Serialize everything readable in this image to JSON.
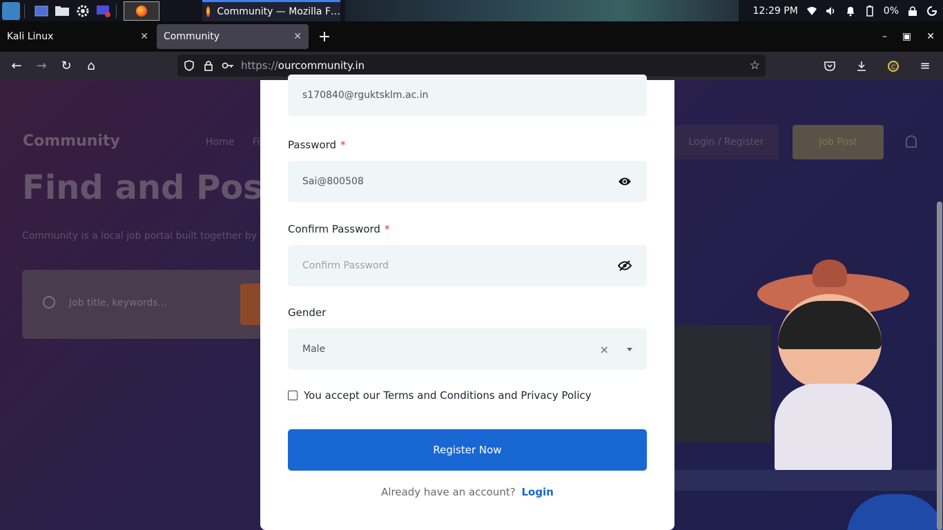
{
  "taskbar": {
    "window_title": "Community — Mozilla F…",
    "clock": "12:29 PM",
    "battery": "0%"
  },
  "browser": {
    "tabs": [
      {
        "label": "Kali Linux",
        "active": false
      },
      {
        "label": "Community",
        "active": true
      }
    ],
    "url_protocol": "https://",
    "url_host": "ourcommunity.in"
  },
  "background_page": {
    "brand": "Community",
    "nav_home": "Home",
    "nav_partial": "Fi",
    "hero_title": "Find and Post In",
    "hero_subtitle": "Community is a local job portal built together by Stude",
    "search_placeholder": "Job title, keywords...",
    "login_register": "Login / Register",
    "job_post": "Job Post"
  },
  "form": {
    "email_value": "s170840@rguktsklm.ac.in",
    "password_label": "Password",
    "password_value": "Sai@800508",
    "confirm_label": "Confirm Password",
    "confirm_placeholder": "Confirm Password",
    "gender_label": "Gender",
    "gender_value": "Male",
    "clear_symbol": "×",
    "required_marker": "*",
    "terms_text": "You accept our Terms and Conditions and Privacy Policy",
    "terms_checked": false,
    "register_label": "Register Now",
    "have_account_text": "Already have an account?",
    "login_label": "Login"
  },
  "colors": {
    "primary": "#1967d2",
    "required": "#e03131",
    "field_bg": "#f0f5f7"
  }
}
